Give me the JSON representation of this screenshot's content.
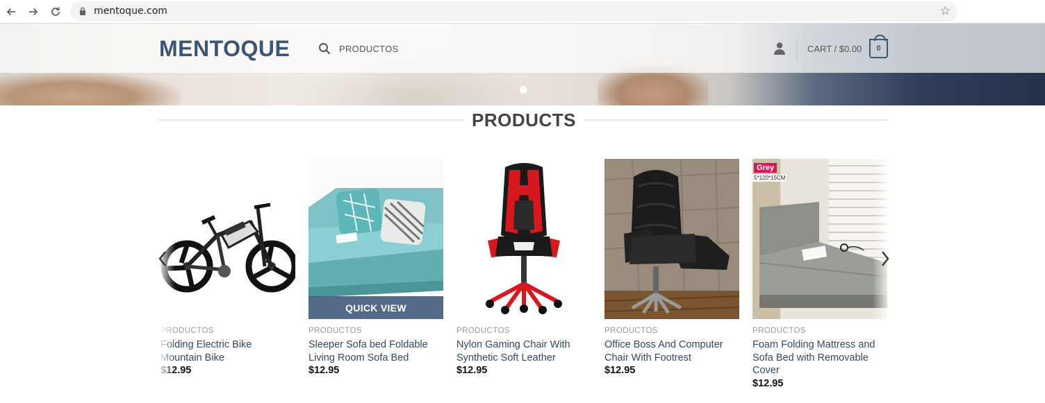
{
  "browser": {
    "url": "mentoque.com"
  },
  "header": {
    "logo": "MENTOQUE",
    "nav_productos": "PRODUCTOS",
    "cart_label": "CART / $0.00",
    "cart_count": "0",
    "colors": {
      "brand": "#3b5577"
    }
  },
  "section": {
    "title": "PRODUCTS"
  },
  "products": [
    {
      "category": "PRODUCTOS",
      "name": "Folding Electric Bike Mountain Bike",
      "price": "$12.95"
    },
    {
      "category": "PRODUCTOS",
      "name": "Sleeper Sofa bed Foldable Living Room Sofa Bed",
      "price": "$12.95",
      "quick_view": "QUICK VIEW"
    },
    {
      "category": "PRODUCTOS",
      "name": "Nylon Gaming Chair With Synthetic Soft Leather",
      "price": "$12.95"
    },
    {
      "category": "PRODUCTOS",
      "name": "Office Boss And Computer Chair With Footrest",
      "price": "$12.95"
    },
    {
      "category": "PRODUCTOS",
      "name": "Foam Folding Mattress and Sofa Bed with Removable Cover",
      "price": "$12.95",
      "badge": "Grey",
      "dimension_label": "5*120*15CM"
    }
  ],
  "icons": {
    "back": "arrow-left-icon",
    "forward": "arrow-right-icon",
    "reload": "reload-icon",
    "lock": "lock-icon",
    "bookmark": "star-icon",
    "search": "search-icon",
    "account": "user-icon",
    "cart": "cart-bag-icon",
    "prev": "chevron-left-icon",
    "next": "chevron-right-icon"
  }
}
